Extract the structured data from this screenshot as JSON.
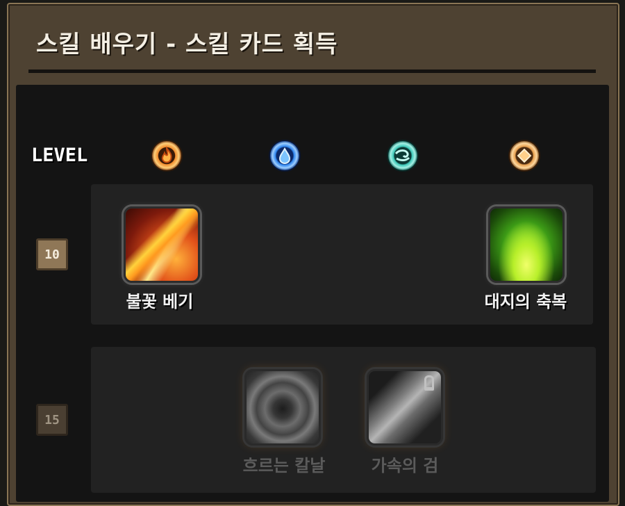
{
  "window": {
    "title": "스킬 배우기 - 스킬 카드 획득"
  },
  "header_row": {
    "level_label": "LEVEL",
    "elements": [
      {
        "name": "fire",
        "icon": "fire-element-icon",
        "color": "#f08a2a"
      },
      {
        "name": "water",
        "icon": "water-element-icon",
        "color": "#2f86f0"
      },
      {
        "name": "wind",
        "icon": "wind-element-icon",
        "color": "#3cc8b8"
      },
      {
        "name": "earth",
        "icon": "earth-element-icon",
        "color": "#e8a050"
      }
    ]
  },
  "rows": [
    {
      "level": "10",
      "unlocked": true,
      "skills": [
        {
          "name": "불꽃 베기",
          "element": "fire",
          "icon": "fire-slash-icon"
        },
        {
          "name": "대지의 축복",
          "element": "earth",
          "icon": "earth-blessing-icon"
        }
      ]
    },
    {
      "level": "15",
      "unlocked": false,
      "skills": [
        {
          "name": "흐르는 칼날",
          "element": "water",
          "icon": "flowing-blade-icon"
        },
        {
          "name": "가속의 검",
          "element": "wind",
          "icon": "acceleration-sword-icon"
        }
      ]
    }
  ],
  "colors": {
    "frame": "#4e4232",
    "panel": "#141414",
    "row_bg": "#222222",
    "badge": "#8f7757"
  }
}
